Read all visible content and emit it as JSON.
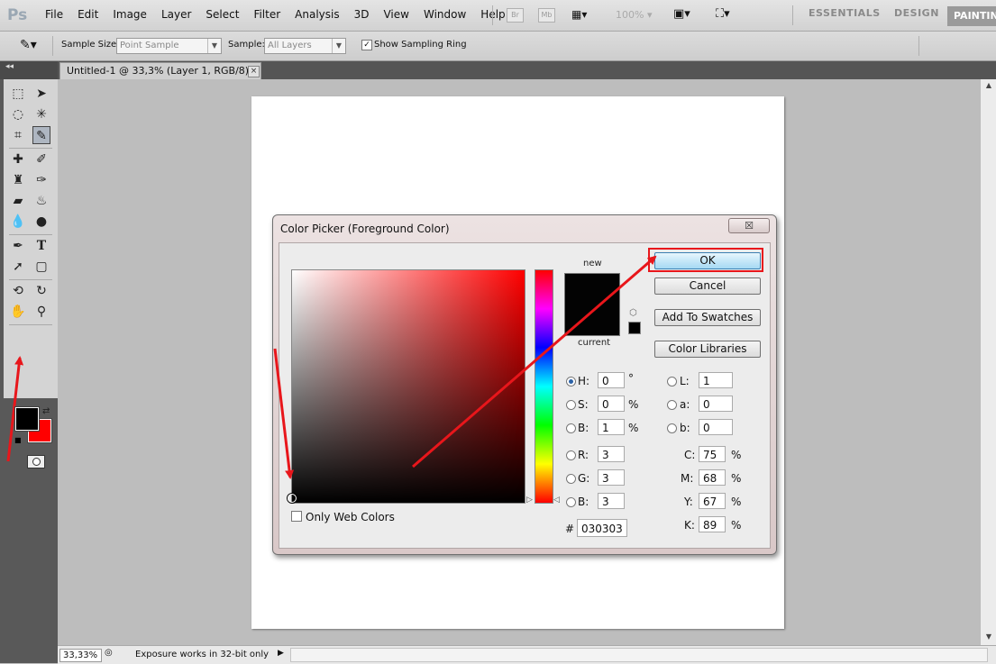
{
  "app": {
    "logo": "Ps"
  },
  "menu": [
    "File",
    "Edit",
    "Image",
    "Layer",
    "Select",
    "Filter",
    "Analysis",
    "3D",
    "View",
    "Window",
    "Help"
  ],
  "appbar": {
    "bridge": "Br",
    "minibridge": "Mb",
    "zoom": "100%"
  },
  "workspaces": {
    "essentials": "ESSENTIALS",
    "design": "DESIGN",
    "painting": "PAINTING"
  },
  "options": {
    "sample_size_label": "Sample Size:",
    "sample_size_value": "Point Sample",
    "sample_label": "Sample:",
    "sample_value": "All Layers",
    "ring_label": "Show Sampling Ring",
    "ring_checked": "✓"
  },
  "document_tab": {
    "title": "Untitled-1 @ 33,3% (Layer 1, RGB/8) *",
    "close": "×"
  },
  "status": {
    "zoom": "33,33%",
    "info": "Exposure works in 32-bit only"
  },
  "colors": {
    "foreground": "#000000",
    "background": "#ff0000",
    "annotation": "#e8161b"
  },
  "dialog": {
    "title": "Color Picker (Foreground Color)",
    "close": "☒",
    "new_label": "new",
    "current_label": "current",
    "buttons": {
      "ok": "OK",
      "cancel": "Cancel",
      "add_swatches": "Add To Swatches",
      "color_libraries": "Color Libraries"
    },
    "only_web_colors": "Only Web Colors",
    "hsb": {
      "h": {
        "label": "H:",
        "value": "0",
        "unit": "°"
      },
      "s": {
        "label": "S:",
        "value": "0",
        "unit": "%"
      },
      "b": {
        "label": "B:",
        "value": "1",
        "unit": "%"
      }
    },
    "rgb": {
      "r": {
        "label": "R:",
        "value": "3"
      },
      "g": {
        "label": "G:",
        "value": "3"
      },
      "b": {
        "label": "B:",
        "value": "3"
      }
    },
    "lab": {
      "l": {
        "label": "L:",
        "value": "1"
      },
      "a": {
        "label": "a:",
        "value": "0"
      },
      "b": {
        "label": "b:",
        "value": "0"
      }
    },
    "cmyk": {
      "c": {
        "label": "C:",
        "value": "75",
        "unit": "%"
      },
      "m": {
        "label": "M:",
        "value": "68",
        "unit": "%"
      },
      "y": {
        "label": "Y:",
        "value": "67",
        "unit": "%"
      },
      "k": {
        "label": "K:",
        "value": "89",
        "unit": "%"
      }
    },
    "hex_label": "#",
    "hex_value": "030303"
  }
}
